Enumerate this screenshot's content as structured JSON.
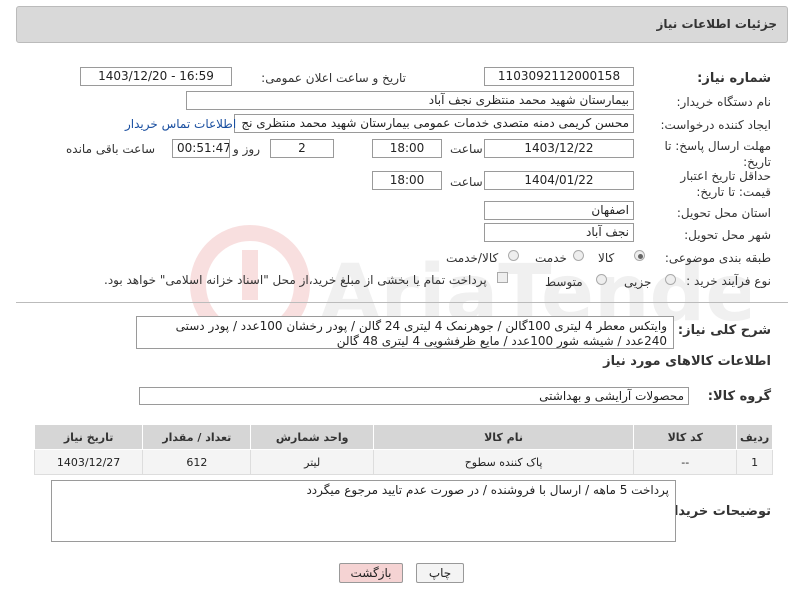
{
  "header": {
    "title": "جزئیات اطلاعات نیاز"
  },
  "form": {
    "need_number": {
      "label": "شماره نیاز:",
      "value": "1103092112000158"
    },
    "announce": {
      "label": "تاریخ و ساعت اعلان عمومی:",
      "value": "1403/12/20 - 16:59"
    },
    "buyer_org": {
      "label": "نام دستگاه خریدار:",
      "value": "بیمارستان شهید محمد منتظری نجف آباد"
    },
    "creator": {
      "label": "ایجاد کننده درخواست:",
      "value": "محسن کریمی دمنه متصدی خدمات عمومی بیمارستان شهید محمد منتظری نج",
      "contact_link": "اطلاعات تماس خریدار"
    },
    "deadline": {
      "label": "مهلت ارسال پاسخ: تا تاریخ:",
      "date": "1403/12/22",
      "time_label": "ساعت",
      "time": "18:00",
      "days": "2",
      "days_label": "روز و",
      "remaining": "00:51:47",
      "remaining_label": "ساعت باقی مانده"
    },
    "validity": {
      "label": "حداقل تاریخ اعتبار قیمت: تا تاریخ:",
      "date": "1404/01/22",
      "time_label": "ساعت",
      "time": "18:00"
    },
    "province": {
      "label": "استان محل تحویل:",
      "value": "اصفهان"
    },
    "city": {
      "label": "شهر محل تحویل:",
      "value": "نجف آباد"
    },
    "category": {
      "label": "طبقه بندی موضوعی:",
      "options": [
        "کالا",
        "خدمت",
        "کالا/خدمت"
      ],
      "selected": "کالا"
    },
    "purchase_type": {
      "label": "نوع فرآیند خرید :",
      "options": [
        "جزیی",
        "متوسط"
      ],
      "note": "پرداخت تمام یا بخشی از مبلغ خرید،از محل \"اسناد خزانه اسلامی\" خواهد بود."
    }
  },
  "description": {
    "label": "شرح کلی نیاز:",
    "text": "وایتکس معطر 4 لیتری 100گالن / جوهرنمک 4 لیتری 24 گالن / پودر رخشان 100عدد / پودر دستی 240عدد / شیشه شور 100عدد / مایع ظرفشویی 4 لیتری 48 گالن"
  },
  "goods": {
    "section_title": "اطلاعات کالاهای مورد نیاز",
    "group_label": "گروه کالا:",
    "group_value": "محصولات آرایشی و بهداشتی",
    "columns": [
      "ردیف",
      "کد کالا",
      "نام کالا",
      "واحد شمارش",
      "تعداد / مقدار",
      "تاریخ نیاز"
    ],
    "rows": [
      {
        "row": "1",
        "code": "--",
        "name": "پاک کننده سطوح",
        "unit": "لیتر",
        "qty": "612",
        "date": "1403/12/27"
      }
    ]
  },
  "buyer_notes": {
    "label": "توضیحات خریدار:",
    "text": "پرداخت 5 ماهه / ارسال با فروشنده / در صورت عدم تایید مرجوع میگردد"
  },
  "buttons": {
    "print": "چاپ",
    "back": "بازگشت"
  },
  "watermark": {
    "text": "AriaTender.net"
  }
}
